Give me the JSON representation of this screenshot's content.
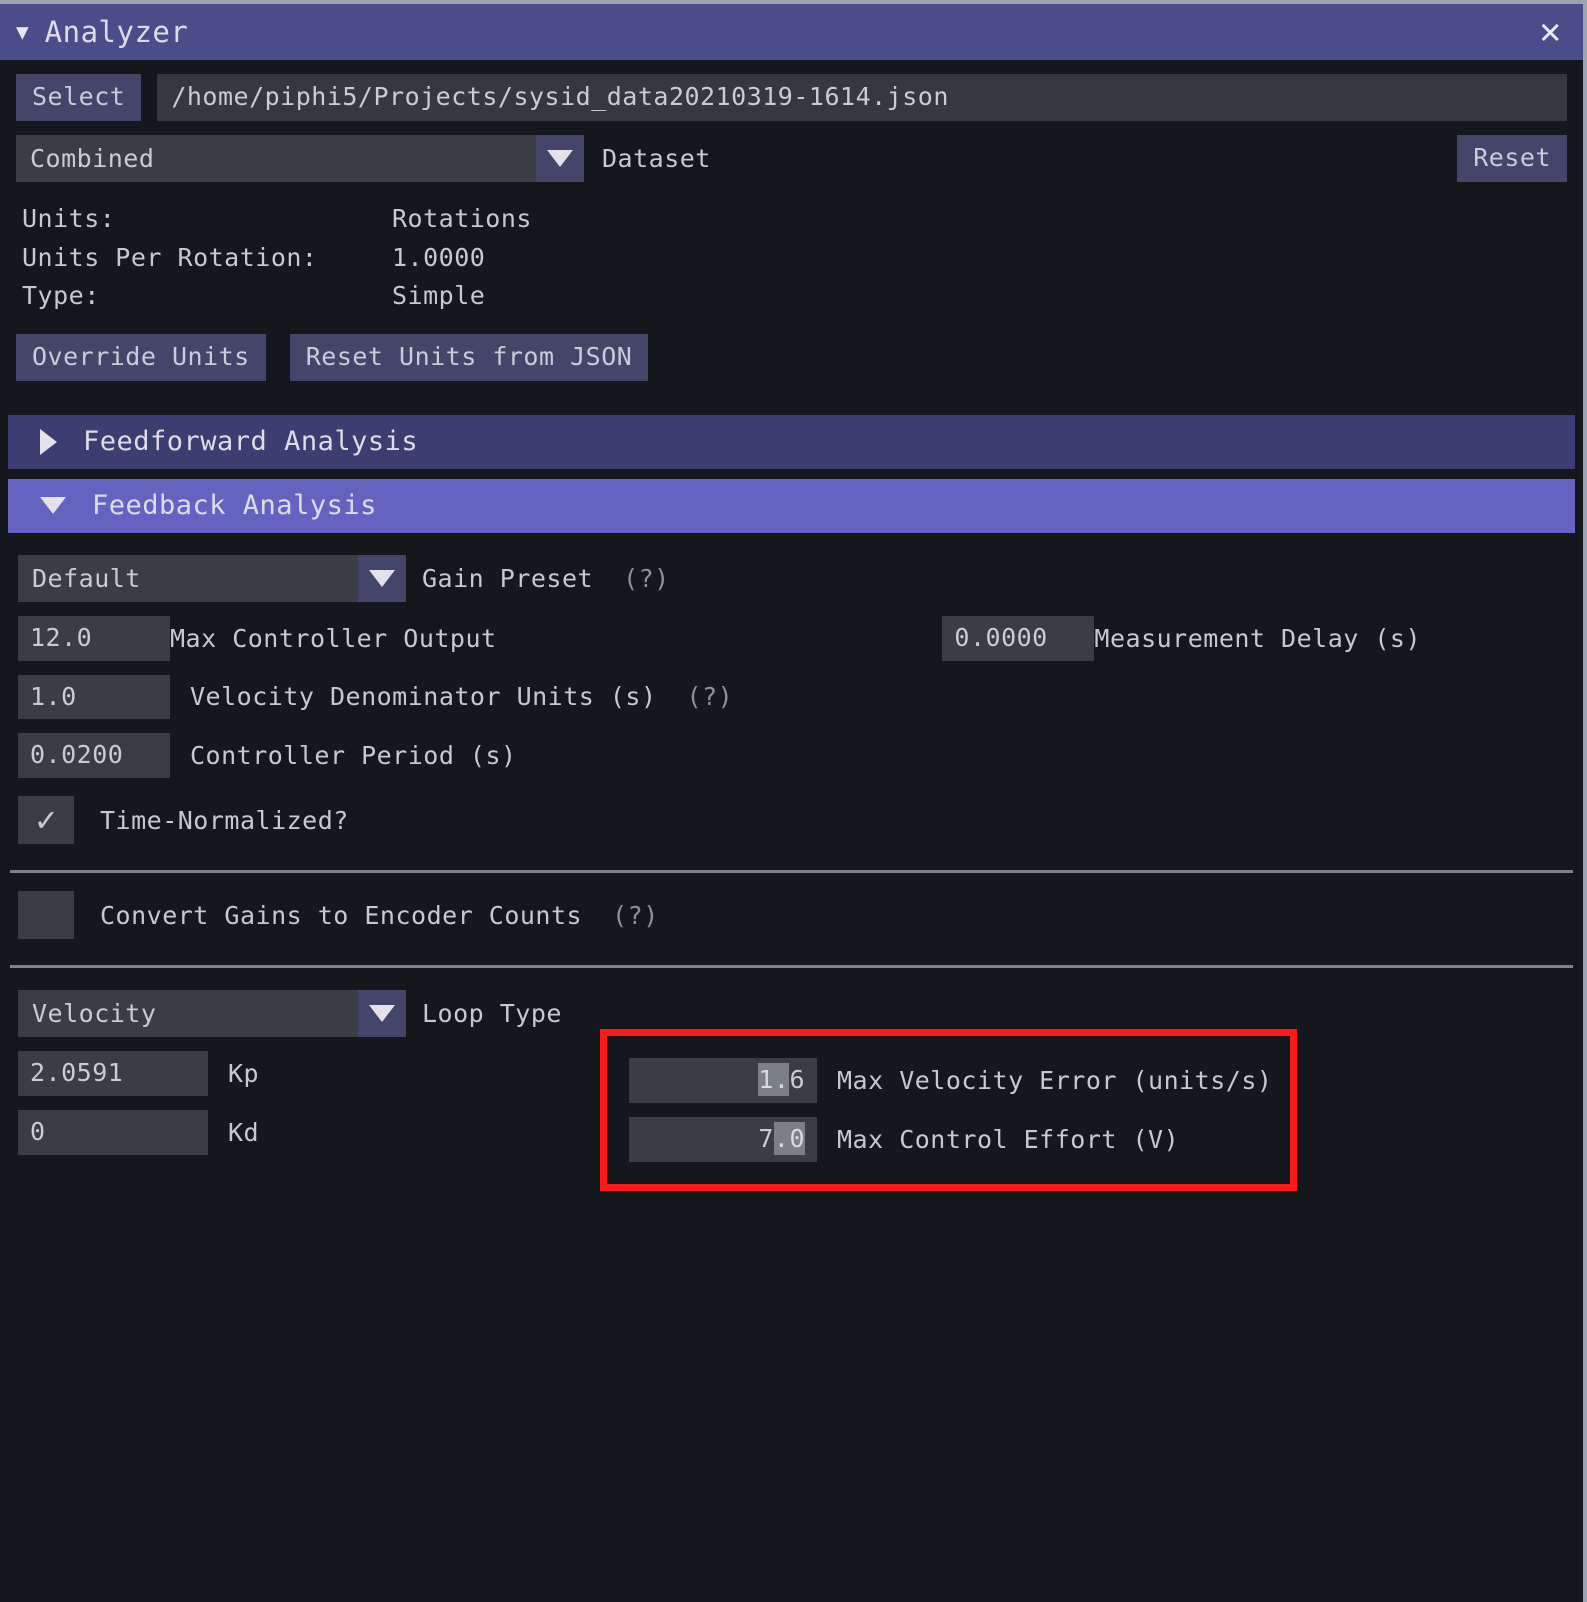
{
  "window": {
    "title": "Analyzer",
    "caret_icon": "caret-down-icon",
    "close_icon": "close-icon"
  },
  "file": {
    "select_label": "Select",
    "path": "/home/piphi5/Projects/sysid_data20210319-1614.json"
  },
  "dataset": {
    "value": "Combined",
    "label": "Dataset",
    "reset_label": "Reset"
  },
  "units_info": {
    "units_key": "Units:",
    "units_value": "Rotations",
    "upr_key": "Units Per Rotation:",
    "upr_value": "1.0000",
    "type_key": "Type:",
    "type_value": "Simple",
    "override_label": "Override Units",
    "reset_json_label": "Reset Units from JSON"
  },
  "sections": {
    "feedforward": {
      "label": "Feedforward Analysis",
      "expanded": false,
      "icon": "caret-right-icon"
    },
    "feedback": {
      "label": "Feedback Analysis",
      "expanded": true,
      "icon": "caret-down-icon"
    }
  },
  "feedback": {
    "gain_preset": {
      "value": "Default",
      "label": "Gain Preset",
      "help": "(?)"
    },
    "max_controller_output": {
      "value": "12.0",
      "label": "Max Controller Output"
    },
    "measurement_delay": {
      "value": "0.0000",
      "label": "Measurement Delay (s)"
    },
    "velocity_denominator_units": {
      "value": "1.0",
      "label": "Velocity Denominator Units (s)",
      "help": "(?)"
    },
    "controller_period": {
      "value": "0.0200",
      "label": "Controller Period (s)"
    },
    "time_normalized": {
      "label": "Time-Normalized?",
      "checked": true,
      "tick": "✓"
    },
    "convert_gains": {
      "label": "Convert Gains to Encoder Counts",
      "checked": false,
      "help": "(?)"
    },
    "loop_type": {
      "value": "Velocity",
      "label": "Loop Type"
    },
    "kp": {
      "value": "2.0591",
      "label": "Kp"
    },
    "kd": {
      "value": "0",
      "label": "Kd"
    },
    "max_velocity_error": {
      "value_selected": "1.",
      "value_rest": "6",
      "label": "Max Velocity Error (units/s)"
    },
    "max_control_effort": {
      "value_prefix": "7",
      "value_selected": ".0",
      "label": "Max Control Effort (V)"
    }
  },
  "colors": {
    "titlebar": "#4b4d8b",
    "section_expanded": "#6563c0",
    "section_collapsed": "#3c3d70",
    "button": "#434668",
    "field": "#3a3d41",
    "background": "#14171c",
    "highlight_box": "#ff1a1a",
    "text_selection": "#7b7f86"
  }
}
